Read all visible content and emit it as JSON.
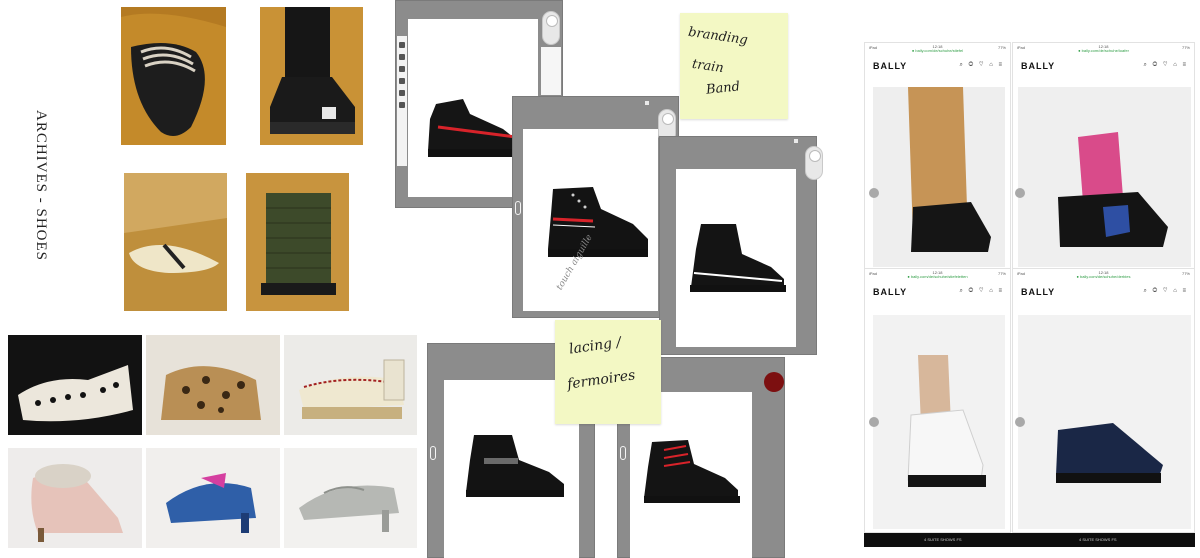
{
  "archives": {
    "title": "ARCHIVES - SHOES"
  },
  "sticky_notes": [
    {
      "lines": [
        "branding",
        "train",
        "Band"
      ]
    },
    {
      "lines": [
        "lacing /",
        "fermoires"
      ]
    }
  ],
  "sketch_annotation": "touch aiguille",
  "phones": [
    {
      "status_left": "iPad",
      "status_time": "12:18",
      "status_url": "● bally.com/de/schuhe/stiefel",
      "status_right": "77%",
      "logo": "BALLY",
      "icons": "⌕ ◎ ♡ ⌂ ≡"
    },
    {
      "status_left": "iPad",
      "status_time": "12:18",
      "status_url": "● bally.com/de/schuhe/loafer",
      "status_right": "77%",
      "logo": "BALLY",
      "icons": "⌕ ◎ ♡ ⌂ ≡"
    },
    {
      "status_left": "iPad",
      "status_time": "12:18",
      "status_url": "● bally.com/de/schuhe/stiefeletten",
      "status_right": "77%",
      "logo": "BALLY",
      "icons": "⌕ ◎ ♡ ⌂ ≡"
    },
    {
      "status_left": "iPad",
      "status_time": "12:18",
      "status_url": "● bally.com/de/schuhe/derbies",
      "status_right": "77%",
      "logo": "BALLY",
      "icons": "⌕ ◎ ♡ ⌂ ≡"
    }
  ],
  "footer": {
    "left_text": "4 SUITE SHOWS FS",
    "right_text": "4 SUITE SHOWS FS"
  },
  "colors": {
    "tablet_frame": "#8c8c8c",
    "sticky_note": "#f3f8c4",
    "swatch_red": "#7c0f10",
    "accent_red": "#d8232a"
  }
}
